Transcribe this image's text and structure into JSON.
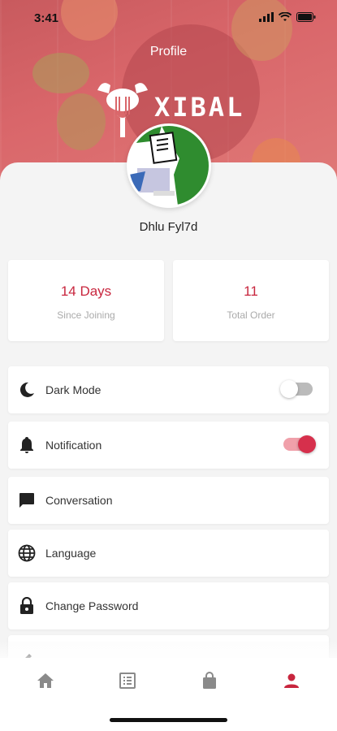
{
  "status": {
    "time": "3:41"
  },
  "header": {
    "title": "Profile",
    "logo_text": "XIBAL"
  },
  "profile": {
    "name": "Dhlu Fyl7d"
  },
  "stats": [
    {
      "value": "14 Days",
      "label": "Since Joining"
    },
    {
      "value": "11",
      "label": "Total Order"
    }
  ],
  "menu": {
    "dark_mode": {
      "label": "Dark Mode",
      "enabled": false
    },
    "notification": {
      "label": "Notification",
      "enabled": true
    },
    "conversation": {
      "label": "Conversation"
    },
    "language": {
      "label": "Language"
    },
    "change_password": {
      "label": "Change Password"
    }
  },
  "tabs": [
    {
      "icon": "home-icon",
      "active": false
    },
    {
      "icon": "orders-icon",
      "active": false
    },
    {
      "icon": "shopping-bag-icon",
      "active": false
    },
    {
      "icon": "profile-icon",
      "active": true
    }
  ],
  "colors": {
    "accent": "#c8263e",
    "tab_inactive": "#8a8a8a",
    "hero": "#d9666a"
  }
}
